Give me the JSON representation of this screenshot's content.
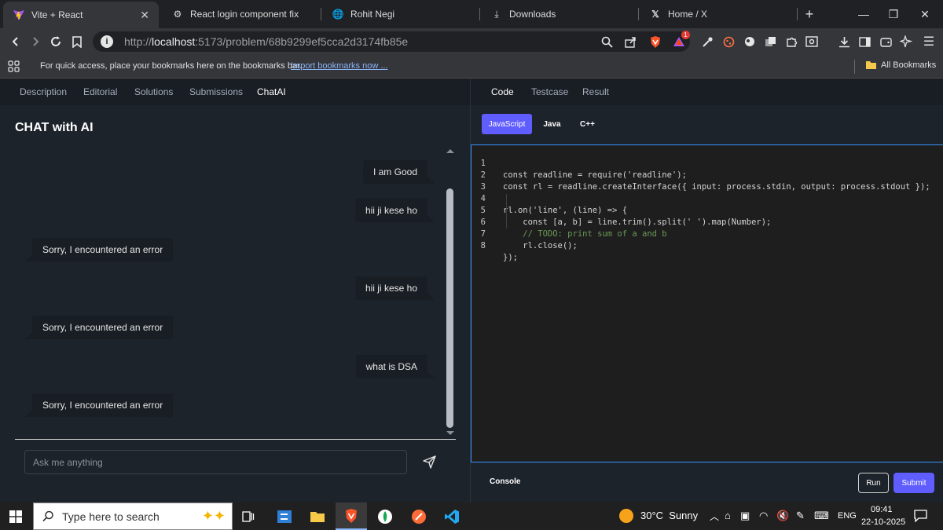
{
  "browser": {
    "tabs": [
      {
        "title": "Vite + React",
        "active": true
      },
      {
        "title": "React login component fix"
      },
      {
        "title": "Rohit Negi"
      },
      {
        "title": "Downloads"
      },
      {
        "title": "Home / X"
      }
    ],
    "url_prefix": "http://",
    "url_host": "localhost",
    "url_path": ":5173/problem/68b9299ef5cca2d3174fb85e",
    "notification_badge": "1",
    "bookmarks_text": "For quick access, place your bookmarks here on the bookmarks bar.",
    "bookmarks_link": "Import bookmarks now ...",
    "all_bookmarks": "All Bookmarks"
  },
  "left_tabs": [
    "Description",
    "Editorial",
    "Solutions",
    "Submissions",
    "ChatAI"
  ],
  "chat": {
    "title": "CHAT with AI",
    "messages": [
      {
        "role": "user",
        "text": "I am Good"
      },
      {
        "role": "user",
        "text": "hii ji kese ho"
      },
      {
        "role": "ai",
        "text": "Sorry, I encountered an error"
      },
      {
        "role": "user",
        "text": "hii ji kese ho"
      },
      {
        "role": "ai",
        "text": "Sorry, I encountered an error"
      },
      {
        "role": "user",
        "text": "what is DSA"
      },
      {
        "role": "ai",
        "text": "Sorry, I encountered an error"
      }
    ],
    "input_placeholder": "Ask me anything"
  },
  "right_tabs": [
    "Code",
    "Testcase",
    "Result"
  ],
  "languages": [
    "JavaScript",
    "Java",
    "C++"
  ],
  "code_lines": [
    "const readline = require('readline');",
    "const rl = readline.createInterface({ input: process.stdin, output: process.stdout });",
    "",
    "rl.on('line', (line) => {",
    "    const [a, b] = line.trim().split(' ').map(Number);",
    "    // TODO: print sum of a and b",
    "    rl.close();",
    "});"
  ],
  "line_numbers": [
    "1",
    "2",
    "3",
    "4",
    "5",
    "6",
    "7",
    "8"
  ],
  "console_label": "Console",
  "run_label": "Run",
  "submit_label": "Submit",
  "taskbar": {
    "search_placeholder": "Type here to search",
    "weather": "30°C  Sunny",
    "language": "ENG",
    "time": "09:41",
    "date": "22-10-2025"
  },
  "colors": {
    "accent": "#605dff",
    "editor_border": "#3794ff",
    "panel_bg": "#1d232a"
  }
}
